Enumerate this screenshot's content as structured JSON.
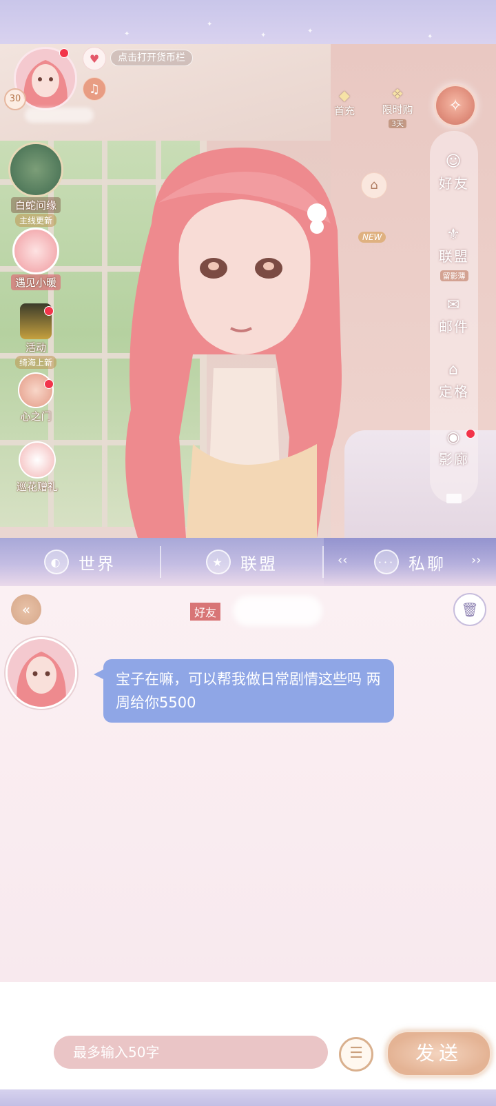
{
  "hud": {
    "level": "30",
    "currency_bar_hint": "点击打开货币栏"
  },
  "promos": {
    "first_recharge": "首充",
    "limited_time": "限时购",
    "limited_days": "3天",
    "new_badge": "NEW"
  },
  "left_events": [
    {
      "label": "白蛇问缘",
      "sublabel": "主线更新"
    },
    {
      "label": "遇见小暖",
      "sublabel": ""
    },
    {
      "label": "活动",
      "sublabel": "绮海上新"
    },
    {
      "label": "心之门",
      "sublabel": ""
    },
    {
      "label": "巡花赠礼",
      "sublabel": ""
    }
  ],
  "right_rail": [
    {
      "label": "好友",
      "sub": ""
    },
    {
      "label": "联盟",
      "sub": "留影薄"
    },
    {
      "label": "邮件",
      "sub": ""
    },
    {
      "label": "定格",
      "sub": ""
    },
    {
      "label": "影廊",
      "sub": ""
    }
  ],
  "tabs": {
    "world": "世界",
    "alliance": "联盟",
    "private": "私聊"
  },
  "chat": {
    "friend_tag": "好友",
    "message": "宝子在嘛，可以帮我做日常剧情这些吗 两周给你5500"
  },
  "input": {
    "placeholder": "最多输入50字",
    "send_label": "发送"
  }
}
